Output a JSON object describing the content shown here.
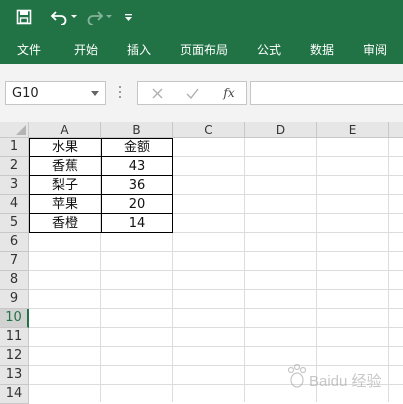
{
  "quick_access": {
    "save_icon": "save-icon",
    "undo_icon": "undo-icon",
    "redo_icon": "redo-icon",
    "customize_icon": "customize-icon"
  },
  "ribbon": {
    "tabs": [
      "文件",
      "开始",
      "插入",
      "页面布局",
      "公式",
      "数据",
      "审阅"
    ]
  },
  "formula_bar": {
    "name_box": "G10",
    "cancel_icon": "cancel-icon",
    "enter_icon": "enter-icon",
    "fx_label": "fx",
    "value": ""
  },
  "sheet": {
    "columns": [
      "A",
      "B",
      "C",
      "D",
      "E"
    ],
    "rows": [
      "1",
      "2",
      "3",
      "4",
      "5",
      "6",
      "7",
      "8",
      "9",
      "10",
      "11",
      "12",
      "13",
      "14"
    ],
    "active_row": "10",
    "table": {
      "header": [
        "水果",
        "金额"
      ],
      "data": [
        [
          "香蕉",
          "43"
        ],
        [
          "梨子",
          "36"
        ],
        [
          "苹果",
          "20"
        ],
        [
          "香橙",
          "14"
        ]
      ]
    }
  },
  "colors": {
    "ribbon_green": "#217346",
    "header_gray": "#e6e6e6",
    "grid_line": "#dcdcdc"
  },
  "watermark_text": "Baidu 经验"
}
